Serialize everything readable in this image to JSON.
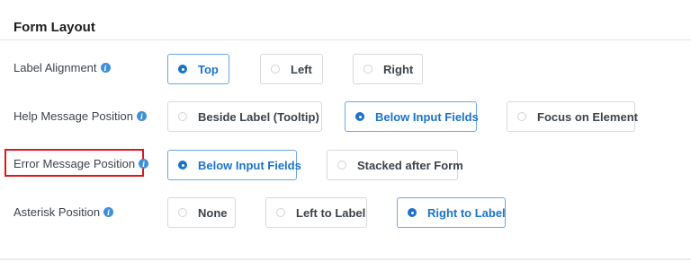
{
  "section": {
    "title": "Form Layout"
  },
  "label_alignment": {
    "label": "Label Alignment",
    "options": [
      {
        "label": "Top",
        "selected": true
      },
      {
        "label": "Left",
        "selected": false
      },
      {
        "label": "Right",
        "selected": false
      }
    ]
  },
  "help_message_position": {
    "label": "Help Message Position",
    "options": [
      {
        "label": "Beside Label (Tooltip)",
        "selected": false
      },
      {
        "label": "Below Input Fields",
        "selected": true
      },
      {
        "label": "Focus on Element",
        "selected": false
      }
    ]
  },
  "error_message_position": {
    "label": "Error Message Position",
    "options": [
      {
        "label": "Below Input Fields",
        "selected": true
      },
      {
        "label": "Stacked after Form",
        "selected": false
      }
    ]
  },
  "asterisk_position": {
    "label": "Asterisk Position",
    "options": [
      {
        "label": "None",
        "selected": false
      },
      {
        "label": "Left to Label",
        "selected": false
      },
      {
        "label": "Right to Label",
        "selected": true
      }
    ]
  },
  "colors": {
    "accent": "#1a73c9",
    "highlight": "#e0161b",
    "info_icon": "#3e8ed8"
  },
  "icons": {
    "info": "info-icon",
    "radio": "radio-icon"
  },
  "info_glyph": "i"
}
